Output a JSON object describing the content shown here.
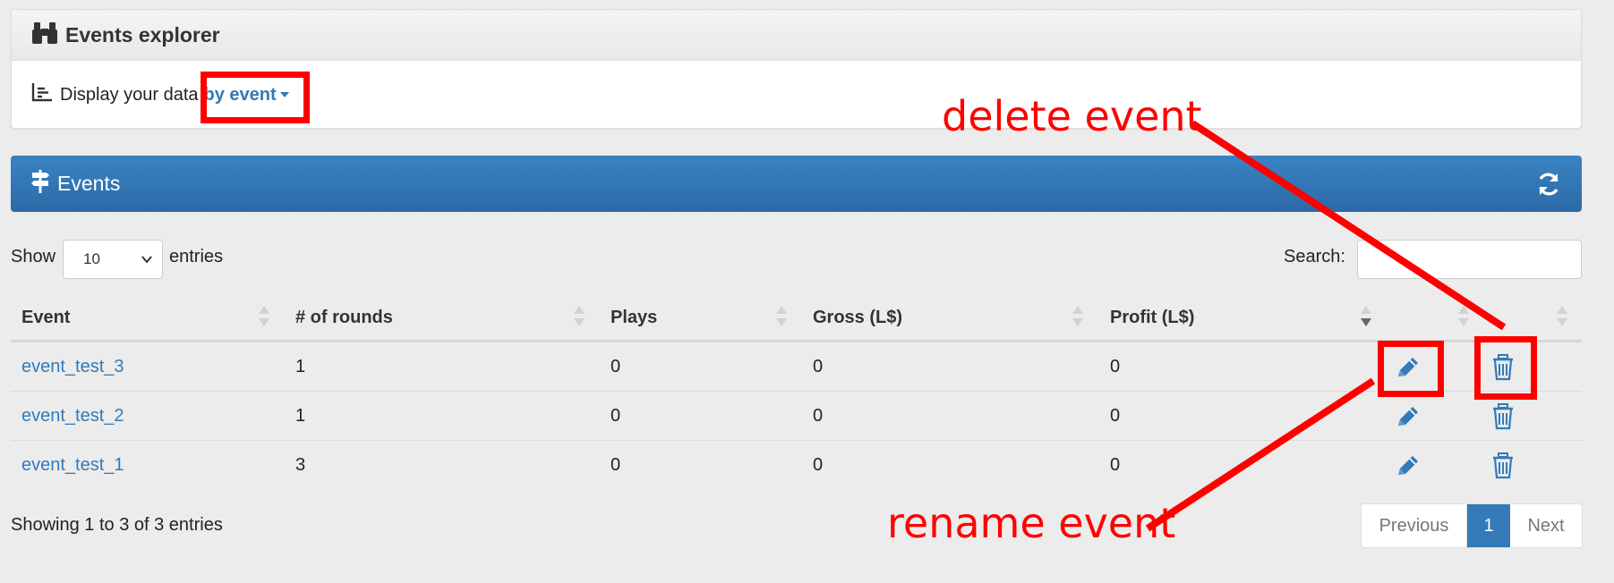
{
  "explorer": {
    "title": "Events explorer",
    "display_label": "Display your data",
    "display_mode": "by event"
  },
  "events_panel": {
    "title": "Events"
  },
  "controls": {
    "show_label": "Show",
    "page_length": "10",
    "entries_label": "entries",
    "search_label": "Search:",
    "search_value": ""
  },
  "table": {
    "columns": [
      "Event",
      "# of rounds",
      "Plays",
      "Gross (L$)",
      "Profit (L$)",
      "",
      ""
    ],
    "rows": [
      {
        "event": "event_test_3",
        "rounds": "1",
        "plays": "0",
        "gross": "0",
        "profit": "0"
      },
      {
        "event": "event_test_2",
        "rounds": "1",
        "plays": "0",
        "gross": "0",
        "profit": "0"
      },
      {
        "event": "event_test_1",
        "rounds": "3",
        "plays": "0",
        "gross": "0",
        "profit": "0"
      }
    ],
    "sorted_column": "Profit (L$)",
    "sort_direction": "descending"
  },
  "footer": {
    "info": "Showing 1 to 3 of 3 entries",
    "previous": "Previous",
    "current_page": "1",
    "next": "Next"
  },
  "annotations": {
    "delete": "delete event",
    "rename": "rename event",
    "color": "#ff0000"
  },
  "colors": {
    "accent": "#337ab7",
    "header_bar": "#2f72b0"
  },
  "icons": [
    "binoculars-icon",
    "chart-lines-icon",
    "signpost-icon",
    "refresh-icon",
    "pencil-icon",
    "trash-icon"
  ]
}
